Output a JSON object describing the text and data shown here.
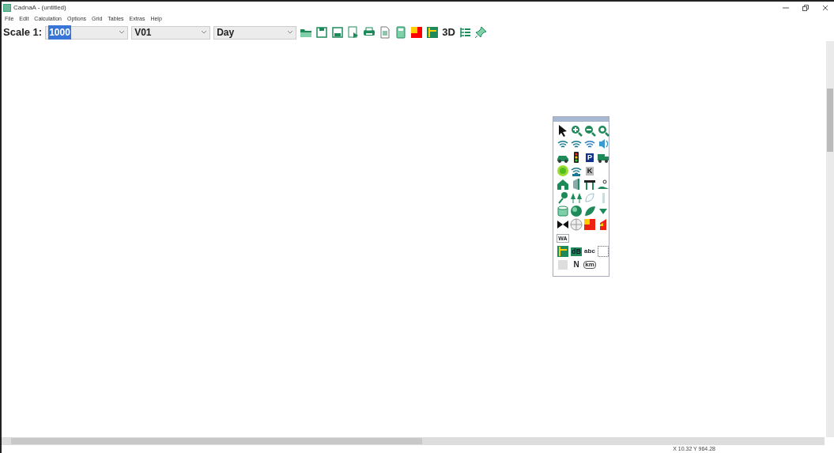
{
  "window": {
    "title": "CadnaA - (untitled)"
  },
  "menu": [
    "File",
    "Edit",
    "Calculation",
    "Options",
    "Grid",
    "Tables",
    "Extras",
    "Help"
  ],
  "toolbar": {
    "scale_label": "Scale 1:",
    "scale_value": "1000",
    "variant": "V01",
    "period": "Day",
    "view_3d": "3D"
  },
  "palette": {
    "labels": [
      "P",
      "K",
      "WA",
      "dB",
      "abc",
      "N",
      "km"
    ]
  },
  "status_bar": {
    "coordinates": "X 10.32 Y 964.28"
  }
}
